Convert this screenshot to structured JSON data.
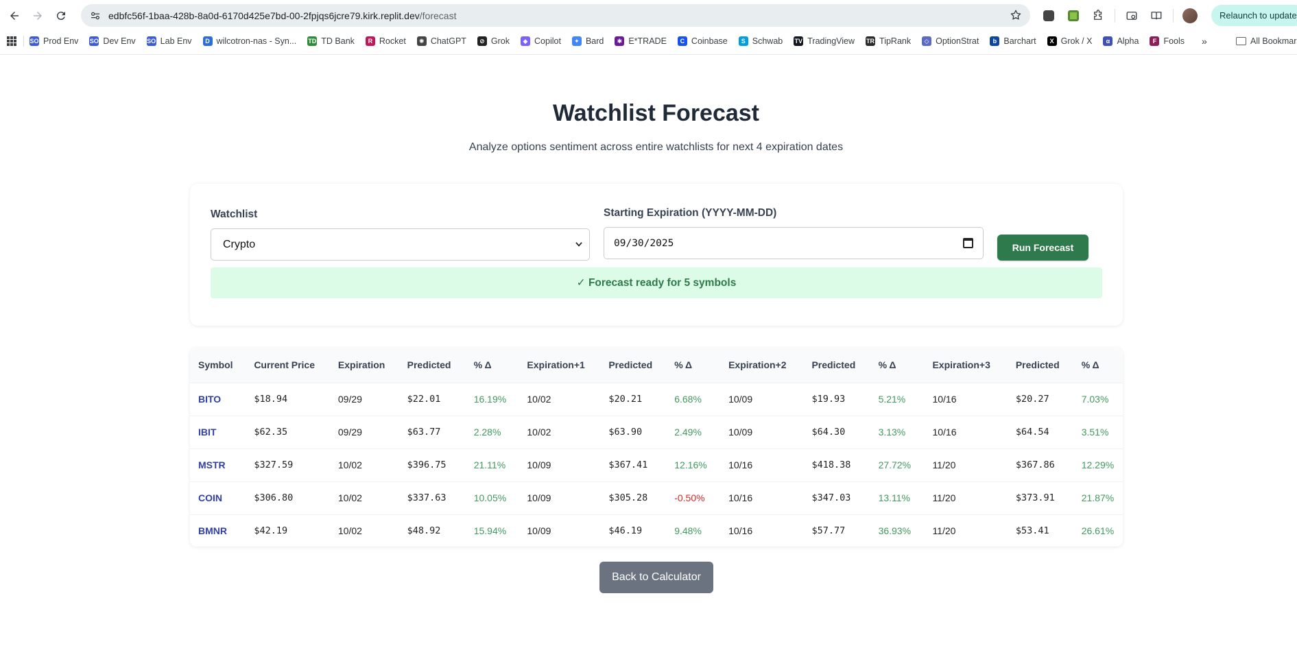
{
  "browser": {
    "url_host": "edbfc56f-1baa-428b-8a0d-6170d425e7bd-00-2fpjqs6jcre79.kirk.replit.dev",
    "url_path": "/forecast",
    "relaunch_label": "Relaunch to update",
    "bookmarks": [
      {
        "label": "Prod Env",
        "icon": "so-icon",
        "color": "#3b5bdb",
        "glyph": "SO"
      },
      {
        "label": "Dev Env",
        "icon": "so-icon",
        "color": "#3b5bdb",
        "glyph": "SO"
      },
      {
        "label": "Lab Env",
        "icon": "so-icon",
        "color": "#3b5bdb",
        "glyph": "SO"
      },
      {
        "label": "wilcotron-nas - Syn...",
        "icon": "dsm-icon",
        "color": "#2d6cdf",
        "glyph": "D"
      },
      {
        "label": "TD Bank",
        "icon": "td-icon",
        "color": "#2e8b3a",
        "glyph": "TD"
      },
      {
        "label": "Rocket",
        "icon": "rocket-icon",
        "color": "#c2185b",
        "glyph": "R"
      },
      {
        "label": "ChatGPT",
        "icon": "chatgpt-icon",
        "color": "#444444",
        "glyph": "✺"
      },
      {
        "label": "Grok",
        "icon": "grok-icon",
        "color": "#222222",
        "glyph": "⊘"
      },
      {
        "label": "Copilot",
        "icon": "copilot-icon",
        "color": "#7b61ff",
        "glyph": "◆"
      },
      {
        "label": "Bard",
        "icon": "bard-icon",
        "color": "#4285f4",
        "glyph": "✦"
      },
      {
        "label": "E*TRADE",
        "icon": "etrade-icon",
        "color": "#6a1b9a",
        "glyph": "✱"
      },
      {
        "label": "Coinbase",
        "icon": "coinbase-icon",
        "color": "#1652f0",
        "glyph": "C"
      },
      {
        "label": "Schwab",
        "icon": "schwab-icon",
        "color": "#00a0df",
        "glyph": "S"
      },
      {
        "label": "TradingView",
        "icon": "tradingview-icon",
        "color": "#131722",
        "glyph": "TV"
      },
      {
        "label": "TipRank",
        "icon": "tipranks-icon",
        "color": "#2b2b2b",
        "glyph": "TR"
      },
      {
        "label": "OptionStrat",
        "icon": "optionstrat-icon",
        "color": "#5c6bc0",
        "glyph": "◇"
      },
      {
        "label": "Barchart",
        "icon": "barchart-icon",
        "color": "#0d47a1",
        "glyph": "b"
      },
      {
        "label": "Grok / X",
        "icon": "x-icon",
        "color": "#000000",
        "glyph": "X"
      },
      {
        "label": "Alpha",
        "icon": "alpha-icon",
        "color": "#3f51b5",
        "glyph": "α"
      },
      {
        "label": "Fools",
        "icon": "fools-icon",
        "color": "#8e1e5a",
        "glyph": "F"
      }
    ],
    "all_bookmarks_label": "All Bookmarks"
  },
  "page": {
    "title": "Watchlist Forecast",
    "subtitle": "Analyze options sentiment across entire watchlists for next 4 expiration dates"
  },
  "form": {
    "watchlist_label": "Watchlist",
    "watchlist_value": "Crypto",
    "expiration_label": "Starting Expiration (YYYY-MM-DD)",
    "expiration_value": "09/30/2025",
    "run_label": "Run Forecast",
    "status_text": "✓ Forecast ready for 5 symbols"
  },
  "table": {
    "headers": [
      "Symbol",
      "Current Price",
      "Expiration",
      "Predicted",
      "% Δ",
      "Expiration+1",
      "Predicted",
      "% Δ",
      "Expiration+2",
      "Predicted",
      "% Δ",
      "Expiration+3",
      "Predicted",
      "% Δ"
    ],
    "rows": [
      [
        "BITO",
        "$18.94",
        "09/29",
        "$22.01",
        "16.19%",
        "10/02",
        "$20.21",
        "6.68%",
        "10/09",
        "$19.93",
        "5.21%",
        "10/16",
        "$20.27",
        "7.03%"
      ],
      [
        "IBIT",
        "$62.35",
        "09/29",
        "$63.77",
        "2.28%",
        "10/02",
        "$63.90",
        "2.49%",
        "10/09",
        "$64.30",
        "3.13%",
        "10/16",
        "$64.54",
        "3.51%"
      ],
      [
        "MSTR",
        "$327.59",
        "10/02",
        "$396.75",
        "21.11%",
        "10/09",
        "$367.41",
        "12.16%",
        "10/16",
        "$418.38",
        "27.72%",
        "11/20",
        "$367.86",
        "12.29%"
      ],
      [
        "COIN",
        "$306.80",
        "10/02",
        "$337.63",
        "10.05%",
        "10/09",
        "$305.28",
        "-0.50%",
        "10/16",
        "$347.03",
        "13.11%",
        "11/20",
        "$373.91",
        "21.87%"
      ],
      [
        "BMNR",
        "$42.19",
        "10/02",
        "$48.92",
        "15.94%",
        "10/09",
        "$46.19",
        "9.48%",
        "10/16",
        "$57.77",
        "36.93%",
        "11/20",
        "$53.41",
        "26.61%"
      ]
    ]
  },
  "back_label": "Back to Calculator",
  "colors": {
    "positive": "#3f9a5d",
    "negative": "#dc2626",
    "symbol": "#2f3fa8",
    "run_button": "#2f7a4d",
    "back_button": "#6b7280"
  }
}
